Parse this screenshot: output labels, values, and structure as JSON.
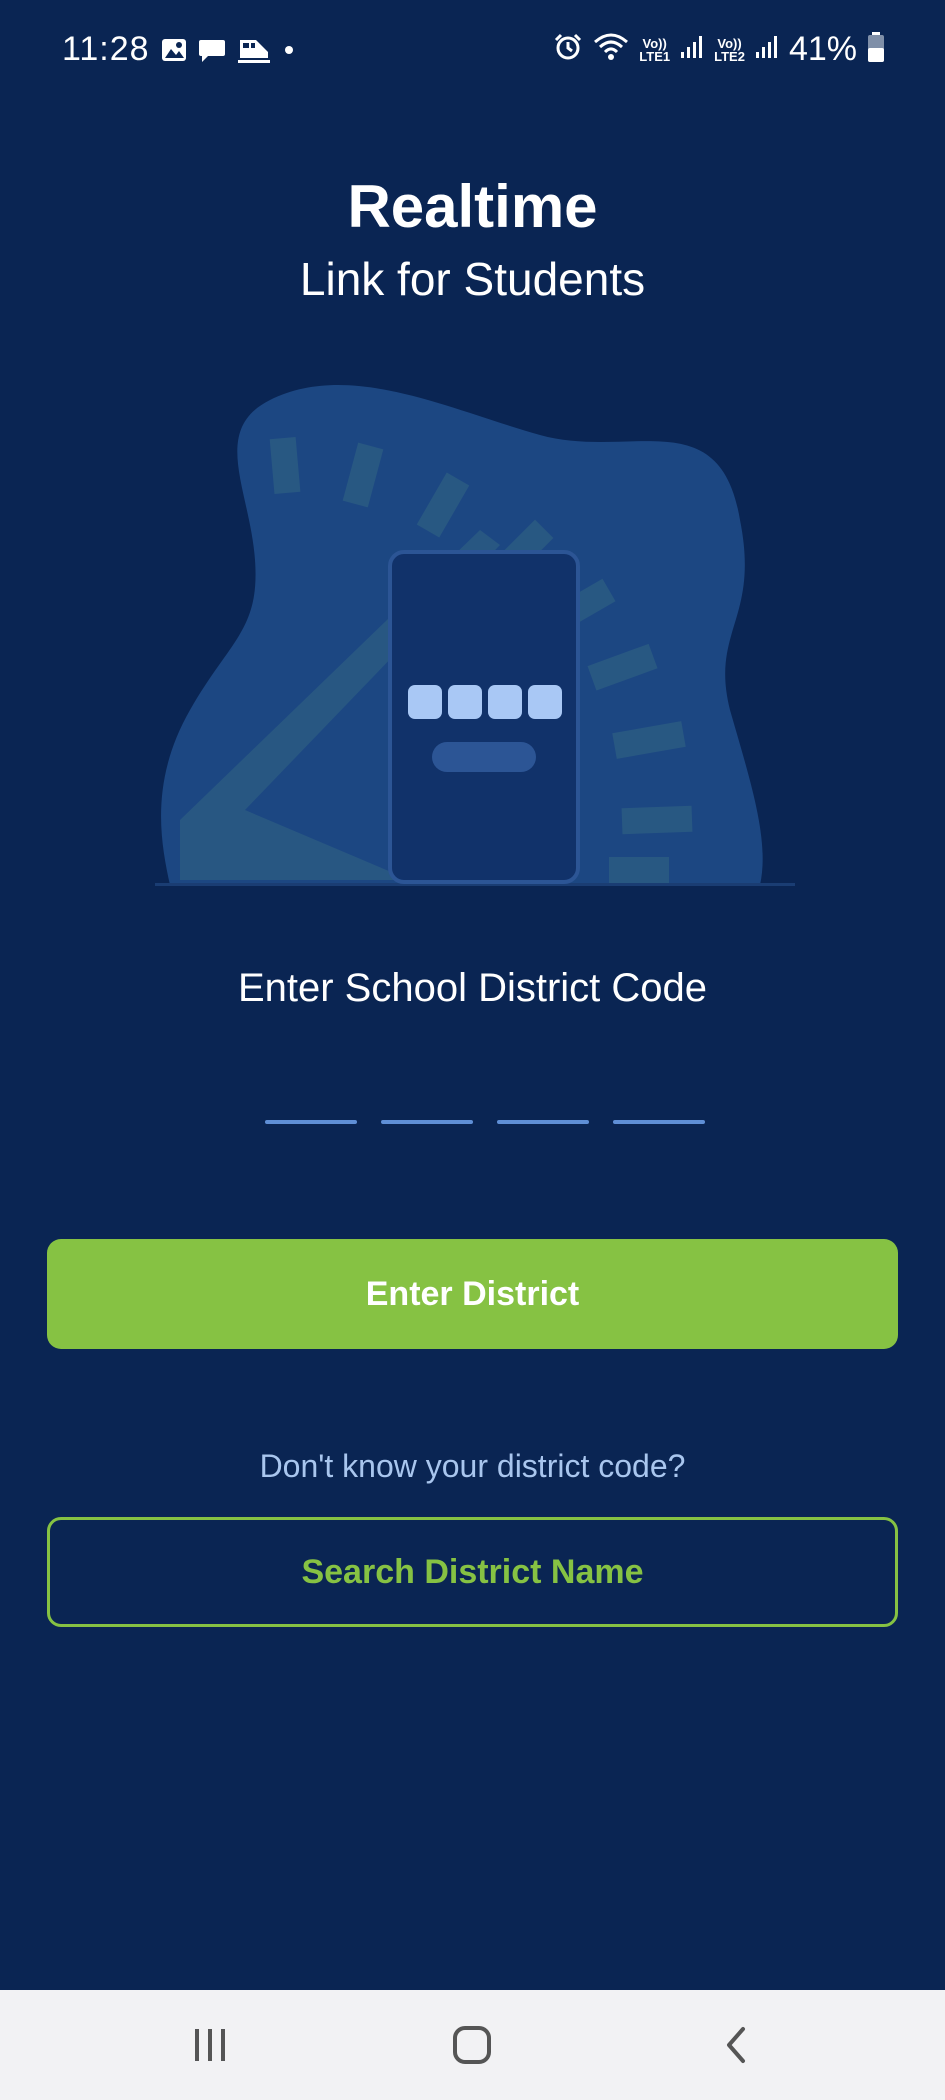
{
  "status_bar": {
    "time": "11:28",
    "battery_percent": "41%",
    "net_labels": [
      "Vo))",
      "LTE1",
      "Vo))",
      "LTE2"
    ],
    "icons": [
      "image-icon",
      "message-icon",
      "train-icon",
      "dot-icon",
      "alarm-icon",
      "wifi-icon",
      "signal-icon",
      "battery-icon"
    ]
  },
  "header": {
    "title": "Realtime",
    "subtitle": "Link for Students"
  },
  "form": {
    "code_label": "Enter School District Code",
    "code_slots": 4,
    "enter_button_label": "Enter District",
    "help_text": "Don't know your district code?",
    "search_button_label": "Search District Name"
  },
  "colors": {
    "background": "#0a2553",
    "accent_green": "#86c243",
    "help_text": "#a9c6ee",
    "slot_line": "#5f8fd6"
  },
  "nav_bar": {
    "icons": [
      "recent-apps-icon",
      "home-icon",
      "back-icon"
    ]
  }
}
